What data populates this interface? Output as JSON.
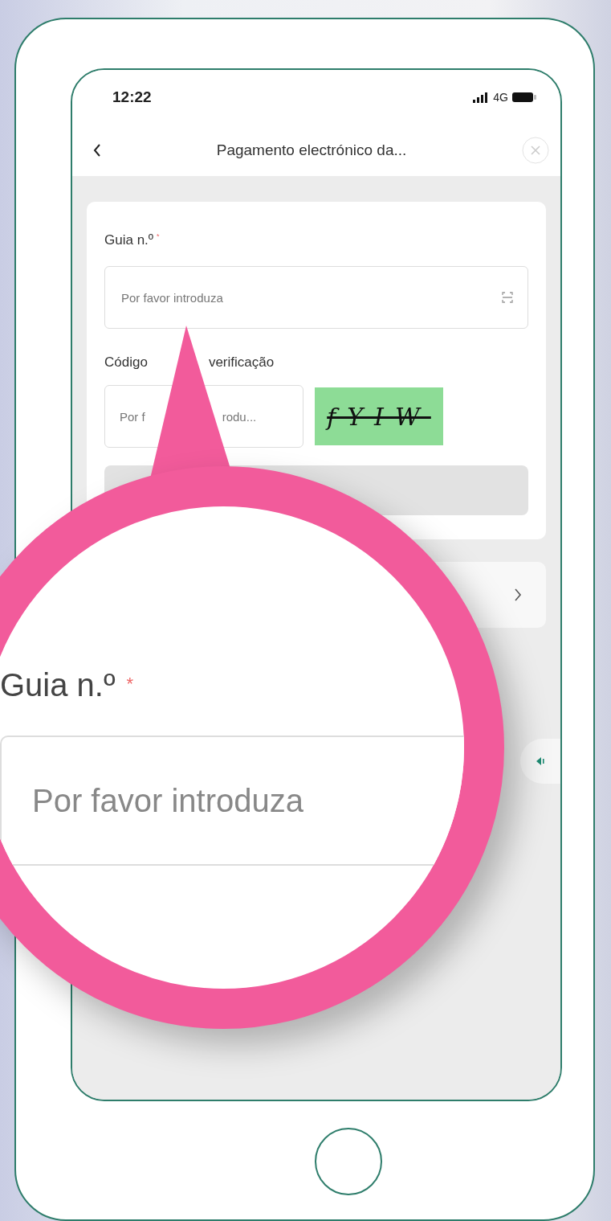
{
  "status_bar": {
    "time": "12:22",
    "network": "4G"
  },
  "nav_bar": {
    "title": "Pagamento electrónico da..."
  },
  "form": {
    "guide_field": {
      "label": "Guia n.º",
      "required_mark": "*",
      "placeholder": "Por favor introduza"
    },
    "code_field": {
      "label_parts": [
        "Código",
        "verificação"
      ],
      "placeholder_parts": [
        "Por f",
        "rodu..."
      ]
    },
    "captcha": {
      "text": "fYIW"
    }
  },
  "magnifier": {
    "label": "Guia n.º",
    "required_mark": "*",
    "placeholder": "Por favor introduza"
  }
}
